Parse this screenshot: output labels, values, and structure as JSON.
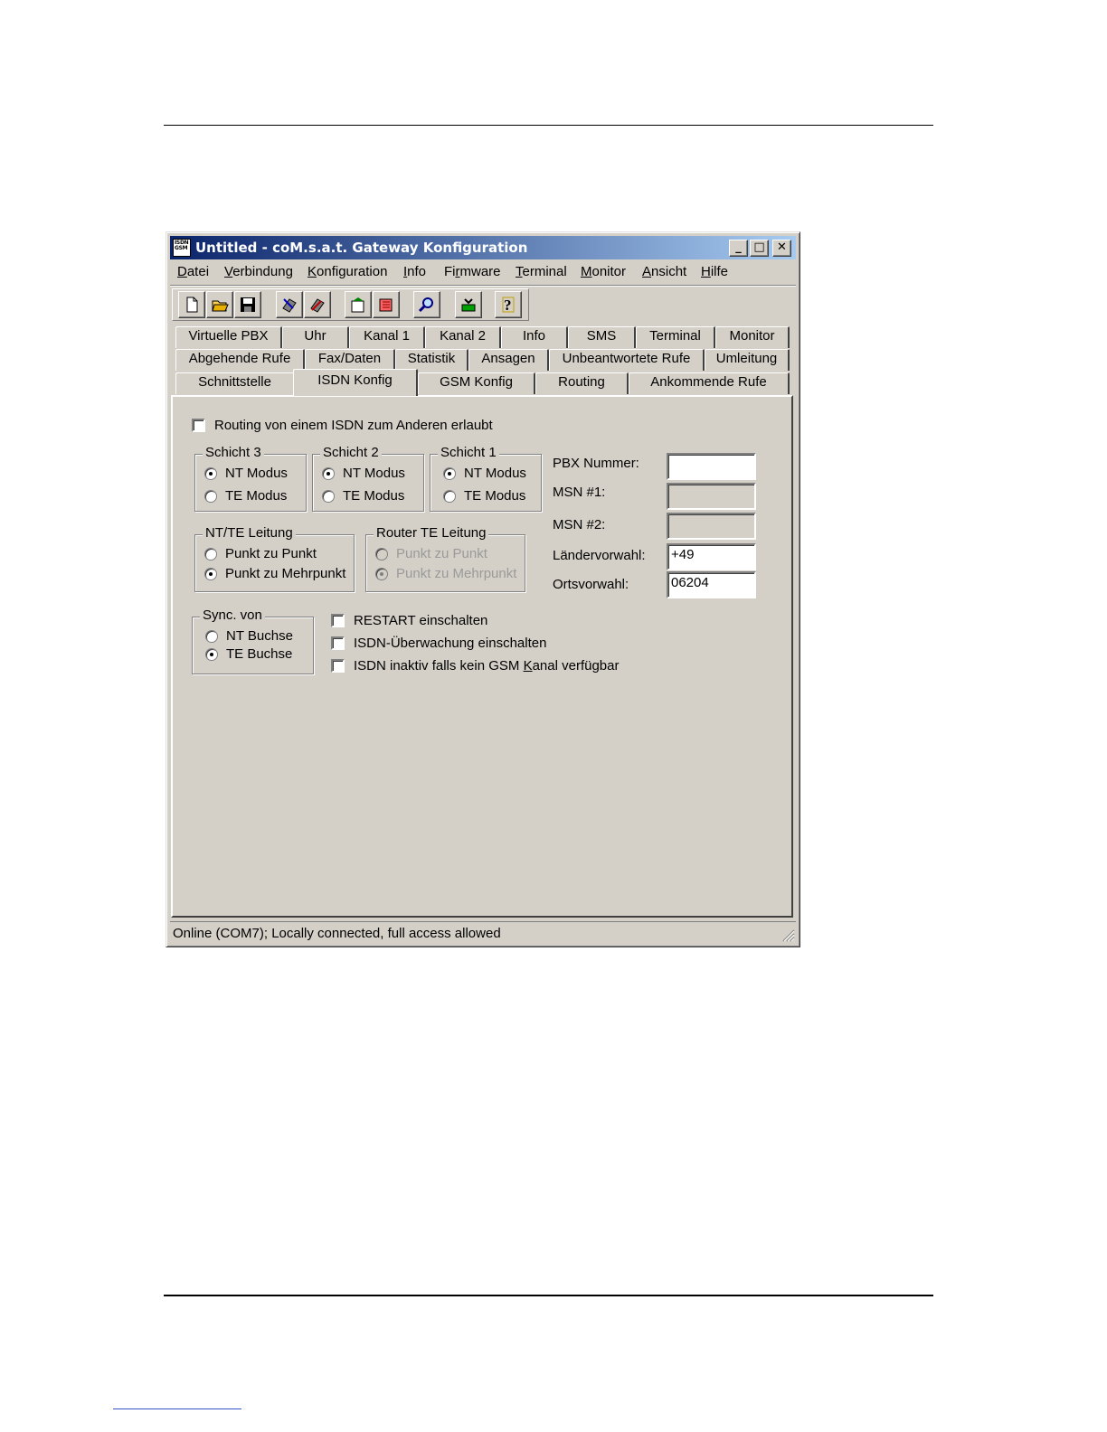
{
  "window": {
    "title": "Untitled - coM.s.a.t. Gateway Konfiguration",
    "app_icon_text": "ISDN GSM",
    "buttons": {
      "minimize": "_",
      "maximize": "□",
      "close": "✕"
    }
  },
  "menu": [
    {
      "pre": "",
      "u": "D",
      "post": "atei"
    },
    {
      "pre": "",
      "u": "V",
      "post": "erbindung"
    },
    {
      "pre": "",
      "u": "K",
      "post": "onfiguration"
    },
    {
      "pre": "",
      "u": "I",
      "post": "nfo"
    },
    {
      "pre": "Fi",
      "u": "r",
      "post": "mware"
    },
    {
      "pre": "",
      "u": "T",
      "post": "erminal"
    },
    {
      "pre": "",
      "u": "M",
      "post": "onitor"
    },
    {
      "pre": "",
      "u": "A",
      "post": "nsicht"
    },
    {
      "pre": "",
      "u": "H",
      "post": "ilfe"
    }
  ],
  "toolbar": [
    "new-file-icon",
    "open-folder-icon",
    "save-icon",
    "read-config-icon",
    "write-config-icon",
    "upload-icon",
    "download-icon",
    "search-icon",
    "firmware-icon",
    "help-icon"
  ],
  "tabs": {
    "row1": [
      "Virtuelle PBX",
      "Uhr",
      "Kanal 1",
      "Kanal 2",
      "Info",
      "SMS",
      "Terminal",
      "Monitor"
    ],
    "row2": [
      "Abgehende Rufe",
      "Fax/Daten",
      "Statistik",
      "Ansagen",
      "Unbeantwortete Rufe",
      "Umleitung"
    ],
    "row3": [
      "Schnittstelle",
      "ISDN Konfig",
      "GSM Konfig",
      "Routing",
      "Ankommende Rufe"
    ],
    "active": "ISDN Konfig"
  },
  "isdn": {
    "routing_checkbox": {
      "label": "Routing von einem ISDN zum Anderen erlaubt",
      "checked": false
    },
    "schicht3": {
      "title": "Schicht 3",
      "nt": "NT Modus",
      "te": "TE Modus",
      "selected": "NT Modus"
    },
    "schicht2": {
      "title": "Schicht 2",
      "nt": "NT Modus",
      "te": "TE Modus",
      "selected": "NT Modus"
    },
    "schicht1": {
      "title": "Schicht 1",
      "nt": "NT Modus",
      "te": "TE Modus",
      "selected": "NT Modus"
    },
    "ntte": {
      "title": "NT/TE Leitung",
      "opt1": "Punkt zu Punkt",
      "opt2": "Punkt zu Mehrpunkt",
      "selected": "Punkt zu Mehrpunkt"
    },
    "router": {
      "title": "Router TE Leitung",
      "opt1": "Punkt zu Punkt",
      "opt2": "Punkt zu Mehrpunkt",
      "selected": "Punkt zu Mehrpunkt",
      "disabled": true
    },
    "sync": {
      "title": "Sync. von",
      "opt1": "NT Buchse",
      "opt2": "TE Buchse",
      "selected": "TE Buchse"
    },
    "restart": {
      "label": "RESTART einschalten",
      "checked": false
    },
    "ueberwachung": {
      "label": "ISDN-Überwachung einschalten",
      "checked": false
    },
    "inaktiv": {
      "pre": "ISDN inaktiv falls kein GSM ",
      "u": "K",
      "post": "anal verfügbar",
      "checked": false
    },
    "pbx_label": "PBX Nummer:",
    "pbx_value": "",
    "msn1_label": "MSN #1:",
    "msn1_value": "",
    "msn2_label": "MSN #2:",
    "msn2_value": "",
    "laender_label": "Ländervorwahl:",
    "laender_value": "+49",
    "orts_label": "Ortsvorwahl:",
    "orts_value": "06204"
  },
  "status": "Online (COM7); Locally connected, full access allowed",
  "colors": {
    "face": "#d4d0c8",
    "title_start": "#0a246a",
    "title_end": "#a6caf0"
  }
}
